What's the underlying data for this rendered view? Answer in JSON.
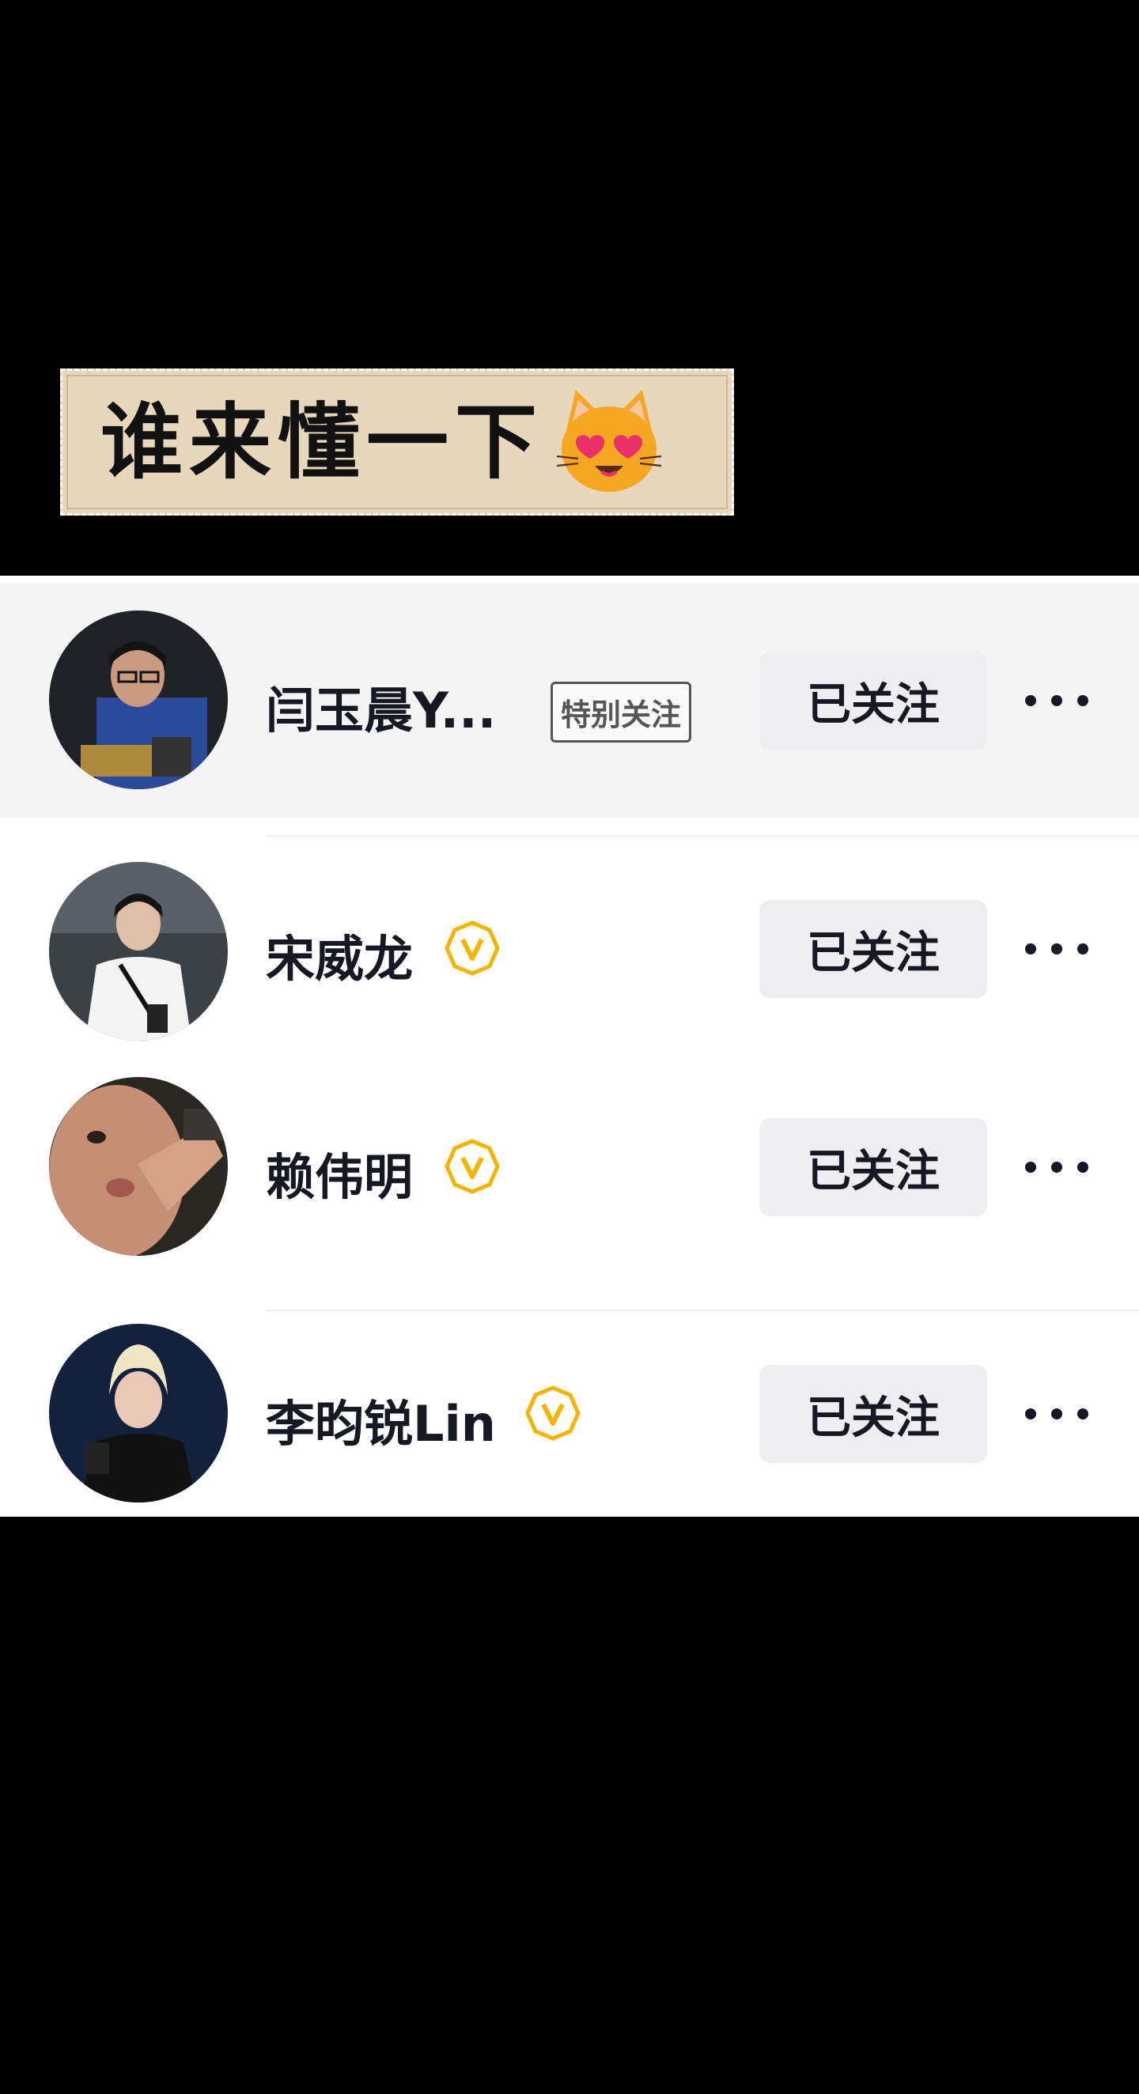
{
  "caption": {
    "text": "谁来懂一下",
    "emoji": "smiling-cat-with-heart-eyes"
  },
  "following_list": [
    {
      "name": "闫玉晨Y...",
      "tag": "特别关注",
      "verified": false,
      "button": "已关注",
      "highlighted": true,
      "avatar": "avatar-photo-dark"
    },
    {
      "name": "宋威龙",
      "tag": "",
      "verified": true,
      "button": "已关注",
      "highlighted": false,
      "avatar": "avatar-photo-white-shirt"
    },
    {
      "name": "赖伟明",
      "tag": "",
      "verified": true,
      "button": "已关注",
      "highlighted": false,
      "avatar": "avatar-photo-closeup"
    },
    {
      "name": "李昀锐Lin",
      "tag": "",
      "verified": true,
      "button": "已关注",
      "highlighted": false,
      "avatar": "avatar-photo-blond"
    }
  ],
  "colors": {
    "badge": "#f4b400",
    "button_bg": "#eeeef0",
    "text": "#161823",
    "highlight_row": "#f4f4f5"
  }
}
